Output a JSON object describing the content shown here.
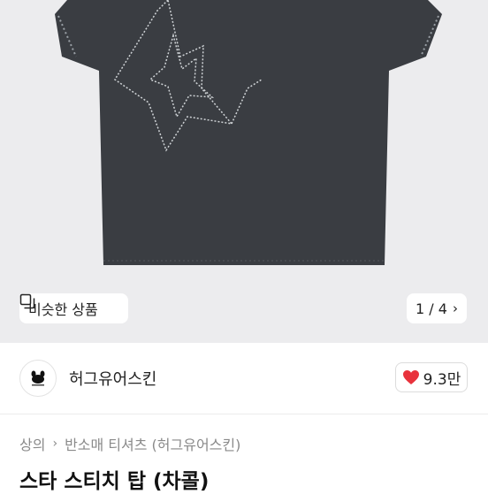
{
  "gallery": {
    "similar_label": "비슷한 상품",
    "pager": "1 / 4"
  },
  "seller": {
    "name": "허그유어스킨",
    "likes": "9.3만"
  },
  "breadcrumb": {
    "category": "상의",
    "subcategory": "반소매 티셔츠 (허그유어스킨)"
  },
  "product": {
    "title": "스타 스티치 탑 (차콜)"
  },
  "colors": {
    "shirt": "#3a3d42",
    "stitch": "#cfd3d6",
    "heart": "#e8323c"
  }
}
